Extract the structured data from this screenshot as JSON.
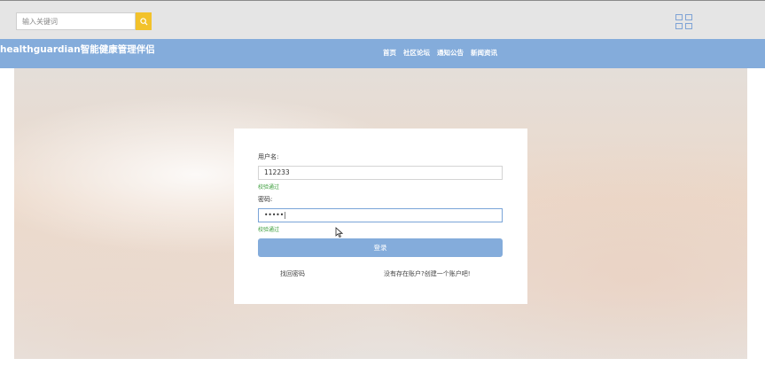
{
  "topbar": {
    "search_placeholder": "输入关键词",
    "search_button_icon": "search-icon",
    "right_icons": [
      "grid-icon"
    ]
  },
  "navbar": {
    "brand": "healthguardian智能健康管理伴侣",
    "links": [
      "首页",
      "社区论坛",
      "通知公告",
      "新闻资讯"
    ]
  },
  "login": {
    "username_label": "用户名:",
    "username_value": "112233",
    "username_validation": "校验通过",
    "password_label": "密码:",
    "password_value": "•••••|",
    "password_validation": "校验通过",
    "submit_label": "登录",
    "forgot_password": "找回密码",
    "register_link": "没有存在账户?创建一个账户吧!"
  },
  "colors": {
    "navbar": "#84acdb",
    "search_button": "#f2c22b",
    "validation": "#3a9d3a",
    "login_button": "#84acdb"
  }
}
